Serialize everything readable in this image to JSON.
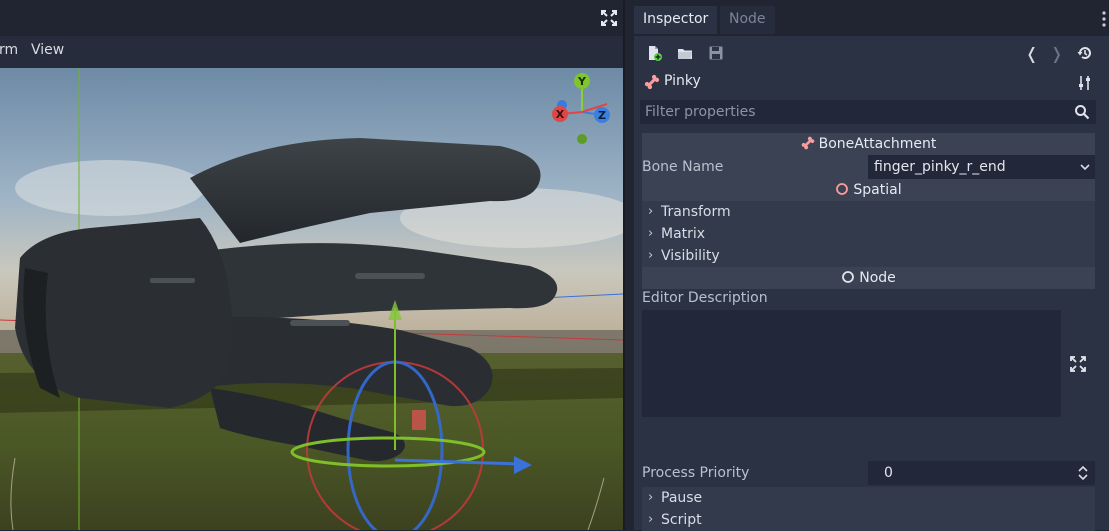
{
  "viewport": {
    "menu": [
      "rm",
      "View"
    ],
    "fullscreen_icon": "fullscreen-icon",
    "gizmo_labels": {
      "x": "X",
      "y": "Y",
      "z": "Z"
    }
  },
  "inspector": {
    "tabs": [
      "Inspector",
      "Node"
    ],
    "history_back": "❬",
    "history_forward": "❭",
    "object_name": "Pinky",
    "filter_placeholder": "Filter properties",
    "sections": {
      "bone_attachment": "BoneAttachment",
      "bone_name_label": "Bone Name",
      "bone_name_value": "finger_pinky_r_end",
      "spatial": "Spatial",
      "transform": "Transform",
      "matrix": "Matrix",
      "visibility": "Visibility",
      "node": "Node",
      "editor_description_label": "Editor Description",
      "process_priority_label": "Process Priority",
      "process_priority_value": "0",
      "pause": "Pause",
      "script": "Script"
    },
    "colors": {
      "accent_bone": "#fc9c9c",
      "panel_bg": "#2b3243",
      "header_bg": "#3a4254"
    }
  }
}
